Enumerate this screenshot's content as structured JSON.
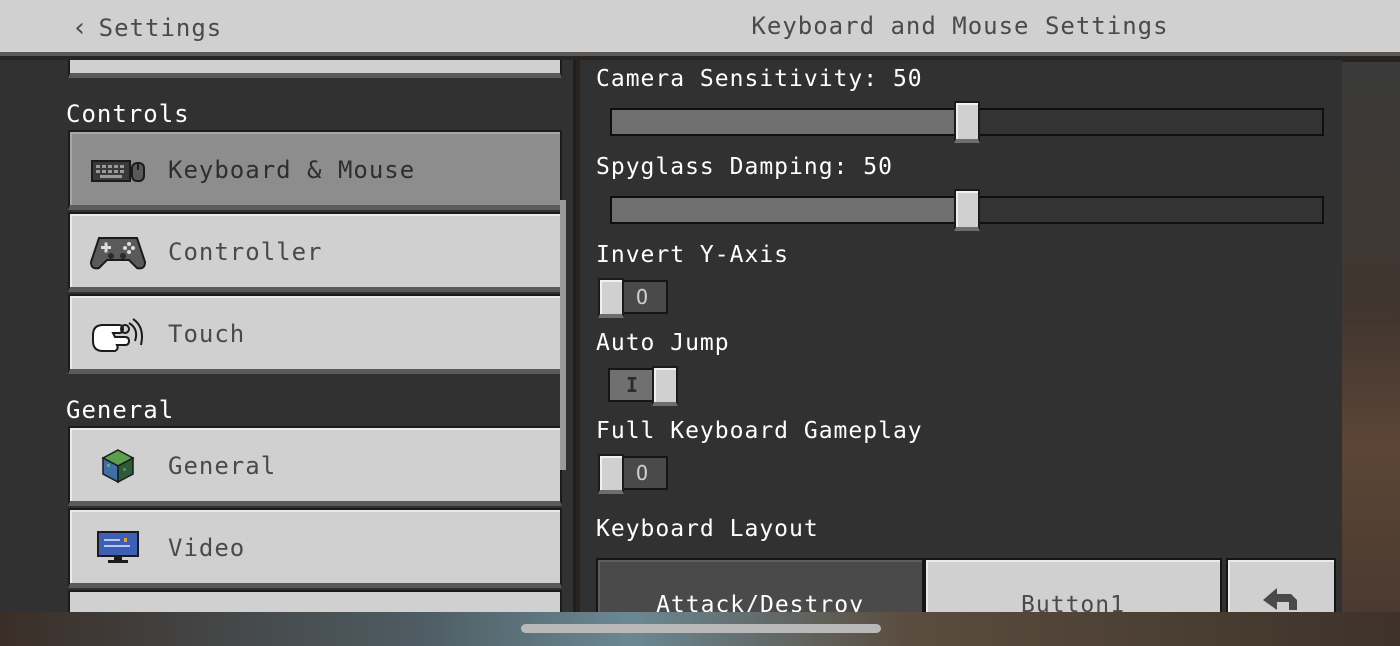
{
  "header": {
    "back_label": "Settings",
    "title": "Keyboard and Mouse Settings"
  },
  "sidebar": {
    "sections": [
      {
        "heading": "Controls",
        "items": [
          {
            "label": "Keyboard & Mouse",
            "icon": "keyboard-mouse-icon",
            "selected": true
          },
          {
            "label": "Controller",
            "icon": "gamepad-icon",
            "selected": false
          },
          {
            "label": "Touch",
            "icon": "touch-hand-icon",
            "selected": false
          }
        ]
      },
      {
        "heading": "General",
        "items": [
          {
            "label": "General",
            "icon": "grass-block-icon",
            "selected": false
          },
          {
            "label": "Video",
            "icon": "monitor-icon",
            "selected": false
          }
        ]
      }
    ]
  },
  "settings": {
    "camera_sensitivity": {
      "label": "Camera Sensitivity: 50",
      "value": 50,
      "max": 100
    },
    "spyglass_damping": {
      "label": "Spyglass Damping: 50",
      "value": 50,
      "max": 100
    },
    "invert_y_axis": {
      "label": "Invert Y-Axis",
      "on": false,
      "glyph": "O"
    },
    "auto_jump": {
      "label": "Auto Jump",
      "on": true,
      "glyph": "I"
    },
    "full_keyboard_gameplay": {
      "label": "Full Keyboard Gameplay",
      "on": false,
      "glyph": "O"
    },
    "keyboard_layout": {
      "heading": "Keyboard Layout",
      "rows": [
        {
          "action": "Attack/Destroy",
          "key": "Button1",
          "reset_icon": "reset-arrow-icon"
        }
      ]
    }
  },
  "colors": {
    "panel_bg": "#313131",
    "button_light": "#d0d0d0",
    "button_selected": "#8d8d8d",
    "text_dark": "#4a4a4a",
    "text_light": "#ffffff"
  }
}
